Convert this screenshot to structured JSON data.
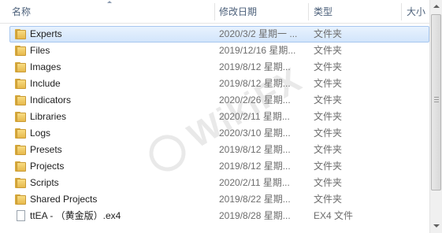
{
  "columns": {
    "name": "名称",
    "date": "修改日期",
    "type": "类型",
    "size": "大小"
  },
  "rows": [
    {
      "name": "Experts",
      "date": "2020/3/2 星期一 ...",
      "type": "文件夹",
      "icon": "folder-icon",
      "selected": true
    },
    {
      "name": "Files",
      "date": "2019/12/16 星期...",
      "type": "文件夹",
      "icon": "folder-icon"
    },
    {
      "name": "Images",
      "date": "2019/8/12 星期...",
      "type": "文件夹",
      "icon": "folder-icon"
    },
    {
      "name": "Include",
      "date": "2019/8/12 星期...",
      "type": "文件夹",
      "icon": "folder-icon"
    },
    {
      "name": "Indicators",
      "date": "2020/2/26 星期...",
      "type": "文件夹",
      "icon": "folder-icon"
    },
    {
      "name": "Libraries",
      "date": "2020/2/11 星期...",
      "type": "文件夹",
      "icon": "folder-icon"
    },
    {
      "name": "Logs",
      "date": "2020/3/10 星期...",
      "type": "文件夹",
      "icon": "folder-icon"
    },
    {
      "name": "Presets",
      "date": "2019/8/12 星期...",
      "type": "文件夹",
      "icon": "folder-icon"
    },
    {
      "name": "Projects",
      "date": "2019/8/12 星期...",
      "type": "文件夹",
      "icon": "folder-icon"
    },
    {
      "name": "Scripts",
      "date": "2020/2/11 星期...",
      "type": "文件夹",
      "icon": "folder-icon"
    },
    {
      "name": "Shared Projects",
      "date": "2019/8/22 星期...",
      "type": "文件夹",
      "icon": "folder-icon"
    },
    {
      "name": "ttEA - （黄金版）.ex4",
      "date": "2019/8/28 星期...",
      "type": "EX4 文件",
      "icon": "file-icon"
    }
  ],
  "watermark": {
    "text": "WikiFX",
    "logo": "wikifx-logo-icon"
  },
  "colors": {
    "selection": "#d2e5fb",
    "selection_border": "#a7c7ef",
    "folder": "#f0c75e",
    "header_text": "#4c607a"
  }
}
